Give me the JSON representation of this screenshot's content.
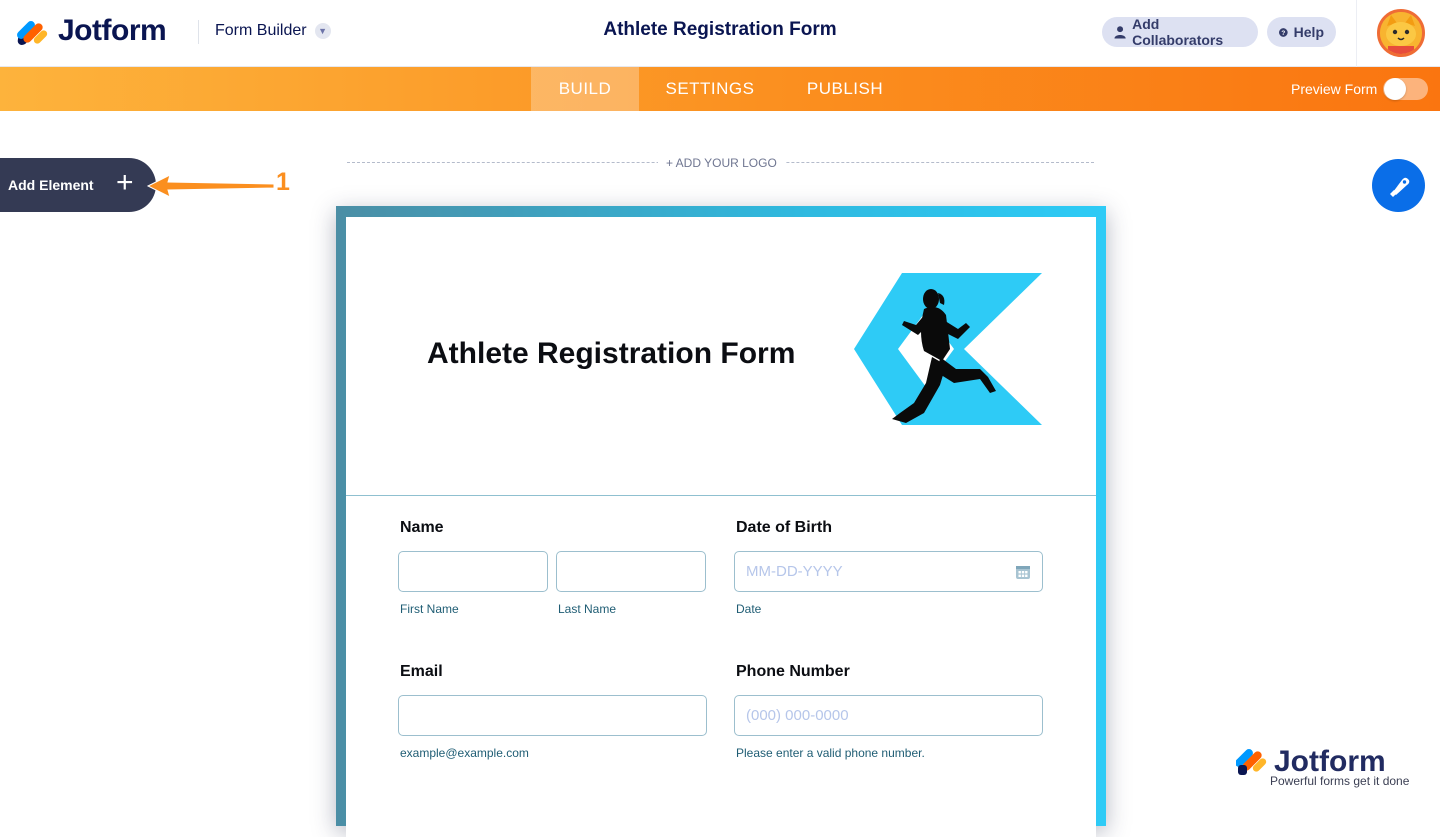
{
  "header": {
    "brand": "Jotform",
    "builder_label": "Form Builder",
    "title": "Athlete Registration Form",
    "add_collaborators": "Add Collaborators",
    "help": "Help"
  },
  "nav": {
    "tabs": [
      "BUILD",
      "SETTINGS",
      "PUBLISH"
    ],
    "active_tab": "BUILD",
    "preview_label": "Preview Form",
    "preview_enabled": false
  },
  "canvas": {
    "add_element": "Add Element",
    "callout_number": "1",
    "add_logo": "+ ADD YOUR LOGO"
  },
  "form": {
    "heading": "Athlete Registration Form",
    "fields": {
      "name": {
        "label": "Name",
        "first_sublabel": "First Name",
        "last_sublabel": "Last Name"
      },
      "dob": {
        "label": "Date of Birth",
        "placeholder": "MM-DD-YYYY",
        "sublabel": "Date"
      },
      "email": {
        "label": "Email",
        "sublabel": "example@example.com"
      },
      "phone": {
        "label": "Phone Number",
        "placeholder": "(000) 000-0000",
        "sublabel": "Please enter a valid phone number."
      }
    }
  },
  "watermark": {
    "brand": "Jotform",
    "tagline": "Powerful forms get it done"
  },
  "colors": {
    "navy": "#0a1551",
    "orange_start": "#fdb33c",
    "orange_end": "#fa7510",
    "form_frame": "#2ecbf6",
    "designer_blue": "#0a6ee8"
  }
}
